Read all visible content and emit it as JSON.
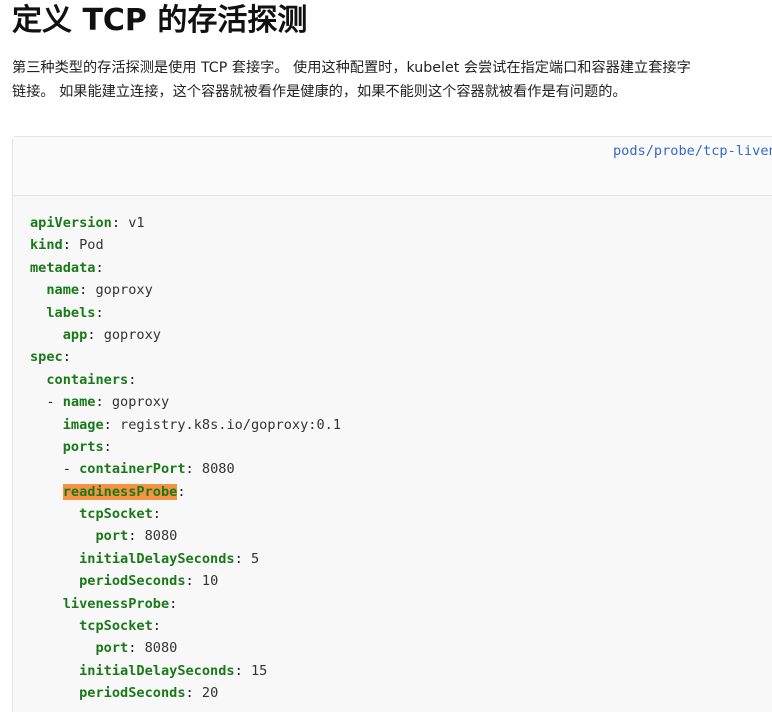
{
  "heading": "定义 TCP 的存活探测",
  "paragraph": {
    "line1": "第三种类型的存活探测是使用 TCP 套接字。 使用这种配置时，kubelet 会尝试在指定端口和容器建立套接字",
    "line2": "链接。 如果能建立连接，这个容器就被看作是健康的，如果不能则这个容器就被看作是有问题的。"
  },
  "code_block": {
    "file_link": "pods/probe/tcp-liveness-readiness.yaml",
    "lines": [
      {
        "indent": "",
        "dash": "",
        "key": "apiVersion",
        "value": "v1"
      },
      {
        "indent": "",
        "dash": "",
        "key": "kind",
        "value": "Pod"
      },
      {
        "indent": "",
        "dash": "",
        "key": "metadata",
        "value": ""
      },
      {
        "indent": "  ",
        "dash": "",
        "key": "name",
        "value": "goproxy"
      },
      {
        "indent": "  ",
        "dash": "",
        "key": "labels",
        "value": ""
      },
      {
        "indent": "    ",
        "dash": "",
        "key": "app",
        "value": "goproxy"
      },
      {
        "indent": "",
        "dash": "",
        "key": "spec",
        "value": ""
      },
      {
        "indent": "  ",
        "dash": "",
        "key": "containers",
        "value": ""
      },
      {
        "indent": "  ",
        "dash": "- ",
        "key": "name",
        "value": "goproxy"
      },
      {
        "indent": "    ",
        "dash": "",
        "key": "image",
        "value": "registry.k8s.io/goproxy:0.1"
      },
      {
        "indent": "    ",
        "dash": "",
        "key": "ports",
        "value": ""
      },
      {
        "indent": "    ",
        "dash": "- ",
        "key": "containerPort",
        "value": "8080"
      },
      {
        "indent": "    ",
        "dash": "",
        "key": "readinessProbe",
        "value": "",
        "highlight": true
      },
      {
        "indent": "      ",
        "dash": "",
        "key": "tcpSocket",
        "value": ""
      },
      {
        "indent": "        ",
        "dash": "",
        "key": "port",
        "value": "8080"
      },
      {
        "indent": "      ",
        "dash": "",
        "key": "initialDelaySeconds",
        "value": "5"
      },
      {
        "indent": "      ",
        "dash": "",
        "key": "periodSeconds",
        "value": "10"
      },
      {
        "indent": "    ",
        "dash": "",
        "key": "livenessProbe",
        "value": ""
      },
      {
        "indent": "      ",
        "dash": "",
        "key": "tcpSocket",
        "value": ""
      },
      {
        "indent": "        ",
        "dash": "",
        "key": "port",
        "value": "8080"
      },
      {
        "indent": "      ",
        "dash": "",
        "key": "initialDelaySeconds",
        "value": "15"
      },
      {
        "indent": "      ",
        "dash": "",
        "key": "periodSeconds",
        "value": "20"
      }
    ]
  },
  "colors": {
    "yaml_key": "#1a7a1a",
    "highlight": "#f59243",
    "link": "#3269c8"
  }
}
